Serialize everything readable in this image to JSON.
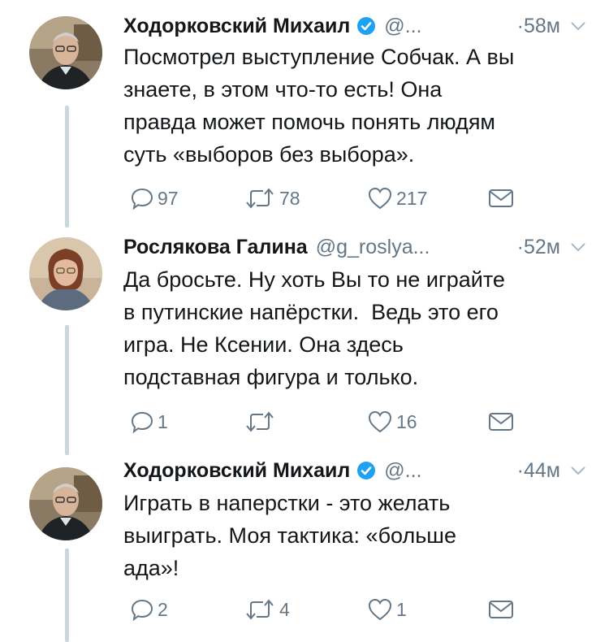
{
  "tweets": [
    {
      "author": "Ходорковский Михаил",
      "handle": "@...",
      "time": "·58м",
      "verified": true,
      "text": "Посмотрел выступление Собчак. А вы\nзнаете, в этом что-то есть! Она\nправда может помочь понять людям\nсуть «выборов без выбора».",
      "replies": "97",
      "retweets": "78",
      "likes": "217"
    },
    {
      "author": "Рослякова Галина",
      "handle": "@g_roslya...",
      "time": "·52м",
      "verified": false,
      "text": "Да бросьте. Ну хоть Вы то не играйте\nв путинские напёрстки.  Ведь это его\nигра. Не Ксении. Она здесь\nподставная фигура и только.",
      "replies": "1",
      "retweets": "",
      "likes": "16"
    },
    {
      "author": "Ходорковский Михаил",
      "handle": "@...",
      "time": "·44м",
      "verified": true,
      "text": "Играть в наперстки - это желать\nвыиграть. Моя тактика: «больше\nада»!",
      "replies": "2",
      "retweets": "4",
      "likes": "1"
    }
  ],
  "icons": {
    "reply": "reply-icon",
    "retweet": "retweet-icon",
    "like": "heart-icon",
    "dm": "envelope-icon",
    "verified": "verified-badge-icon",
    "menu": "chevron-down-icon"
  },
  "colors": {
    "text": "#14171a",
    "secondary": "#657786",
    "verified": "#1da1f2",
    "thread": "#ccd6dd"
  }
}
